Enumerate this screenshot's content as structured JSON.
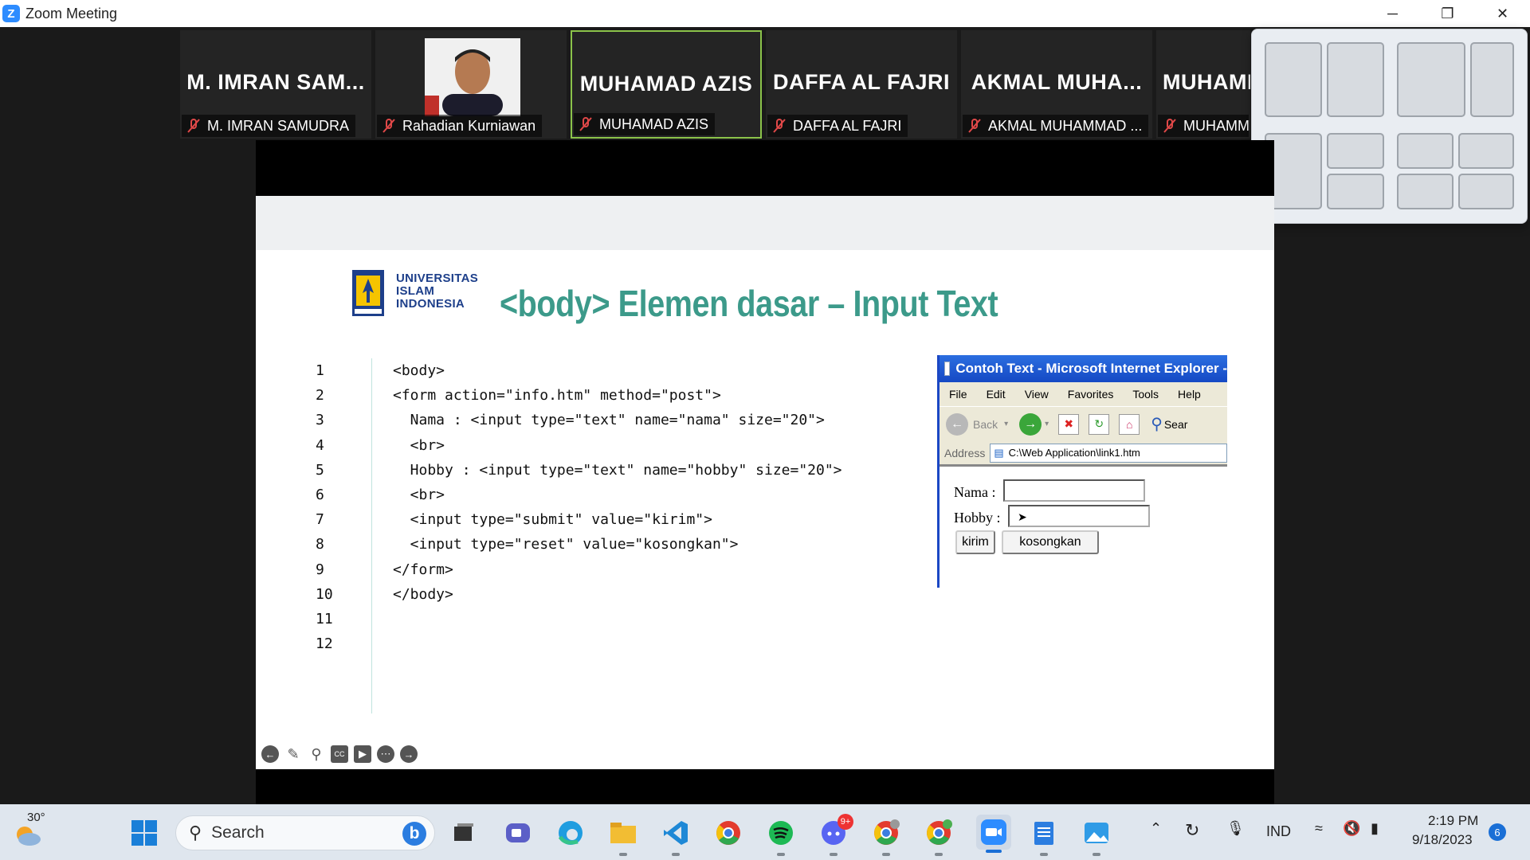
{
  "window": {
    "title": "Zoom Meeting",
    "app_icon": "zoom-icon"
  },
  "window_controls": {
    "minimize": "─",
    "restore": "❐",
    "close": "✕"
  },
  "participants": [
    {
      "big_name": "M. IMRAN SAM...",
      "label": "M. IMRAN SAMUDRA",
      "has_video": false,
      "active": false
    },
    {
      "big_name": "",
      "label": "Rahadian Kurniawan",
      "has_video": true,
      "active": false
    },
    {
      "big_name": "MUHAMAD AZIS",
      "label": "MUHAMAD AZIS",
      "has_video": false,
      "active": true
    },
    {
      "big_name": "DAFFA AL FAJRI",
      "label": "DAFFA AL FAJRI",
      "has_video": false,
      "active": false
    },
    {
      "big_name": "AKMAL MUHA...",
      "label": "AKMAL MUHAMMAD ...",
      "has_video": false,
      "active": false
    },
    {
      "big_name": "MUHAMM",
      "label": "MUHAMM",
      "has_video": false,
      "active": false
    }
  ],
  "slide": {
    "university": [
      "UNIVERSITAS",
      "ISLAM",
      "INDONESIA"
    ],
    "title": "<body> Elemen dasar – Input Text",
    "line_numbers": [
      "1",
      "2",
      "3",
      "4",
      "5",
      "6",
      "7",
      "8",
      "9",
      "10",
      "11",
      "12"
    ],
    "code_lines": [
      "<body>",
      "<form action=\"info.htm\" method=\"post\">",
      "  Nama : <input type=\"text\" name=\"nama\" size=\"20\">",
      "  <br>",
      "  Hobby : <input type=\"text\" name=\"hobby\" size=\"20\">",
      "  <br>",
      "  <input type=\"submit\" value=\"kirim\">",
      "  <input type=\"reset\" value=\"kosongkan\">",
      "</form>",
      "</body>",
      "",
      ""
    ],
    "accent_color": "#3c9a8a"
  },
  "ie_window": {
    "title": "Contoh Text - Microsoft Internet Explorer -",
    "menu": [
      "File",
      "Edit",
      "View",
      "Favorites",
      "Tools",
      "Help"
    ],
    "back_label": "Back",
    "search_label": "Sear",
    "address_label": "Address",
    "address_value": "C:\\Web Application\\link1.htm",
    "nama_label": "Nama :",
    "hobby_label": "Hobby :",
    "submit_label": "kirim",
    "reset_label": "kosongkan"
  },
  "taskbar": {
    "weather_temp": "30°",
    "search_placeholder": "Search",
    "discord_badge": "9+",
    "language": "IND",
    "time": "2:19 PM",
    "date": "9/18/2023",
    "notification_count": "6"
  }
}
